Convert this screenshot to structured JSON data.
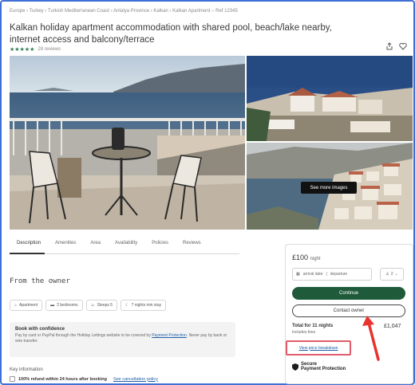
{
  "breadcrumb": "Europe › Turkey › Turkish Mediterranean Coast › Antalya Province › Kalkan › Kalkan Apartment – Ref 12345",
  "listing": {
    "title": "Kalkan holiday apartment accommodation with shared pool, beach/lake nearby, internet access and balcony/terrace",
    "stars": "★★★★★",
    "reviews": "28 reviews"
  },
  "gallery": {
    "see_more": "See more images"
  },
  "tabs": [
    {
      "label": "Description"
    },
    {
      "label": "Amenities"
    },
    {
      "label": "Area"
    },
    {
      "label": "Availability"
    },
    {
      "label": "Policies"
    },
    {
      "label": "Reviews"
    }
  ],
  "owner": {
    "heading": "From the owner",
    "chips": [
      {
        "label": "Apartment"
      },
      {
        "label": "2 bedrooms"
      },
      {
        "label": "Sleeps 5"
      },
      {
        "label": "7 nights min stay"
      }
    ],
    "book_title": "Book with confidence",
    "book_text": "Pay by card or PayPal through the Holiday Lettings website to be covered by",
    "book_link": "Payment Protection",
    "book_text2": ". Never pay by bank or wire transfer."
  },
  "key_info": {
    "heading": "Key information",
    "refund": "100% refund within 24 hours after booking",
    "refund_link": "See cancellation policy"
  },
  "booking": {
    "price": "£100",
    "per": "night",
    "checkin": "arrival date",
    "checkout": "departure",
    "guests": "2",
    "continue": "Continue",
    "contact": "Contact owner",
    "total_label": "Total for 11 nights",
    "total_sub": "includes fees",
    "total_amount": "£1,047",
    "breakdown_link": "View price breakdown",
    "protection": "Payment Protection",
    "protection_prefix": "Secure"
  },
  "colors": {
    "continue_bg": "#1f5b3b",
    "highlight": "#e15b6a",
    "frame": "#3d6fd6"
  }
}
